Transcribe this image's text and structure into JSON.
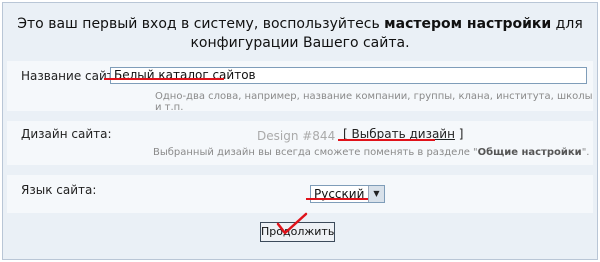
{
  "intro": {
    "before": "Это ваш первый вход в систему, воспользуйтесь ",
    "bold": "мастером настройки",
    "after": " для конфигурации Вашего сайта."
  },
  "site_name": {
    "label": "Название сайта:",
    "value": "Белый каталог сайтов",
    "hint": "Одно-два слова, например, название компании, группы, клана, института, школы и т.п."
  },
  "design": {
    "label": "Дизайн сайта:",
    "current": "Design #844",
    "choose_open": "[",
    "choose_link": "Выбрать дизайн",
    "choose_close": "]",
    "hint_before": "Выбранный дизайн вы всегда сможете поменять в разделе \"",
    "hint_bold": "Общие настройки",
    "hint_after": "\"."
  },
  "language": {
    "label": "Язык сайта:",
    "selected": "Русский"
  },
  "continue_button": "Продолжить",
  "colors": {
    "annotation": "#e0121a",
    "panel": "#eaf0f6",
    "border": "#b9c6d6"
  },
  "icons": {
    "dropdown": "chevron-down-icon",
    "annotation": "checkmark-icon"
  }
}
